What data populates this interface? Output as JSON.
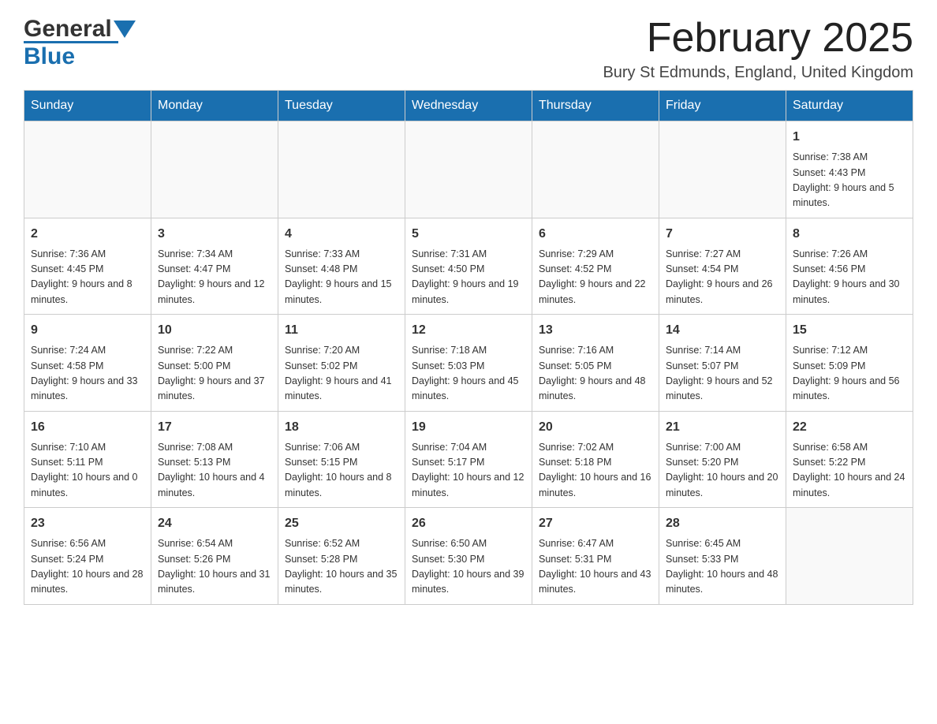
{
  "header": {
    "logo_general": "General",
    "logo_blue": "Blue",
    "title": "February 2025",
    "location": "Bury St Edmunds, England, United Kingdom"
  },
  "weekdays": [
    "Sunday",
    "Monday",
    "Tuesday",
    "Wednesday",
    "Thursday",
    "Friday",
    "Saturday"
  ],
  "weeks": [
    [
      {
        "day": "",
        "sunrise": "",
        "sunset": "",
        "daylight": ""
      },
      {
        "day": "",
        "sunrise": "",
        "sunset": "",
        "daylight": ""
      },
      {
        "day": "",
        "sunrise": "",
        "sunset": "",
        "daylight": ""
      },
      {
        "day": "",
        "sunrise": "",
        "sunset": "",
        "daylight": ""
      },
      {
        "day": "",
        "sunrise": "",
        "sunset": "",
        "daylight": ""
      },
      {
        "day": "",
        "sunrise": "",
        "sunset": "",
        "daylight": ""
      },
      {
        "day": "1",
        "sunrise": "Sunrise: 7:38 AM",
        "sunset": "Sunset: 4:43 PM",
        "daylight": "Daylight: 9 hours and 5 minutes."
      }
    ],
    [
      {
        "day": "2",
        "sunrise": "Sunrise: 7:36 AM",
        "sunset": "Sunset: 4:45 PM",
        "daylight": "Daylight: 9 hours and 8 minutes."
      },
      {
        "day": "3",
        "sunrise": "Sunrise: 7:34 AM",
        "sunset": "Sunset: 4:47 PM",
        "daylight": "Daylight: 9 hours and 12 minutes."
      },
      {
        "day": "4",
        "sunrise": "Sunrise: 7:33 AM",
        "sunset": "Sunset: 4:48 PM",
        "daylight": "Daylight: 9 hours and 15 minutes."
      },
      {
        "day": "5",
        "sunrise": "Sunrise: 7:31 AM",
        "sunset": "Sunset: 4:50 PM",
        "daylight": "Daylight: 9 hours and 19 minutes."
      },
      {
        "day": "6",
        "sunrise": "Sunrise: 7:29 AM",
        "sunset": "Sunset: 4:52 PM",
        "daylight": "Daylight: 9 hours and 22 minutes."
      },
      {
        "day": "7",
        "sunrise": "Sunrise: 7:27 AM",
        "sunset": "Sunset: 4:54 PM",
        "daylight": "Daylight: 9 hours and 26 minutes."
      },
      {
        "day": "8",
        "sunrise": "Sunrise: 7:26 AM",
        "sunset": "Sunset: 4:56 PM",
        "daylight": "Daylight: 9 hours and 30 minutes."
      }
    ],
    [
      {
        "day": "9",
        "sunrise": "Sunrise: 7:24 AM",
        "sunset": "Sunset: 4:58 PM",
        "daylight": "Daylight: 9 hours and 33 minutes."
      },
      {
        "day": "10",
        "sunrise": "Sunrise: 7:22 AM",
        "sunset": "Sunset: 5:00 PM",
        "daylight": "Daylight: 9 hours and 37 minutes."
      },
      {
        "day": "11",
        "sunrise": "Sunrise: 7:20 AM",
        "sunset": "Sunset: 5:02 PM",
        "daylight": "Daylight: 9 hours and 41 minutes."
      },
      {
        "day": "12",
        "sunrise": "Sunrise: 7:18 AM",
        "sunset": "Sunset: 5:03 PM",
        "daylight": "Daylight: 9 hours and 45 minutes."
      },
      {
        "day": "13",
        "sunrise": "Sunrise: 7:16 AM",
        "sunset": "Sunset: 5:05 PM",
        "daylight": "Daylight: 9 hours and 48 minutes."
      },
      {
        "day": "14",
        "sunrise": "Sunrise: 7:14 AM",
        "sunset": "Sunset: 5:07 PM",
        "daylight": "Daylight: 9 hours and 52 minutes."
      },
      {
        "day": "15",
        "sunrise": "Sunrise: 7:12 AM",
        "sunset": "Sunset: 5:09 PM",
        "daylight": "Daylight: 9 hours and 56 minutes."
      }
    ],
    [
      {
        "day": "16",
        "sunrise": "Sunrise: 7:10 AM",
        "sunset": "Sunset: 5:11 PM",
        "daylight": "Daylight: 10 hours and 0 minutes."
      },
      {
        "day": "17",
        "sunrise": "Sunrise: 7:08 AM",
        "sunset": "Sunset: 5:13 PM",
        "daylight": "Daylight: 10 hours and 4 minutes."
      },
      {
        "day": "18",
        "sunrise": "Sunrise: 7:06 AM",
        "sunset": "Sunset: 5:15 PM",
        "daylight": "Daylight: 10 hours and 8 minutes."
      },
      {
        "day": "19",
        "sunrise": "Sunrise: 7:04 AM",
        "sunset": "Sunset: 5:17 PM",
        "daylight": "Daylight: 10 hours and 12 minutes."
      },
      {
        "day": "20",
        "sunrise": "Sunrise: 7:02 AM",
        "sunset": "Sunset: 5:18 PM",
        "daylight": "Daylight: 10 hours and 16 minutes."
      },
      {
        "day": "21",
        "sunrise": "Sunrise: 7:00 AM",
        "sunset": "Sunset: 5:20 PM",
        "daylight": "Daylight: 10 hours and 20 minutes."
      },
      {
        "day": "22",
        "sunrise": "Sunrise: 6:58 AM",
        "sunset": "Sunset: 5:22 PM",
        "daylight": "Daylight: 10 hours and 24 minutes."
      }
    ],
    [
      {
        "day": "23",
        "sunrise": "Sunrise: 6:56 AM",
        "sunset": "Sunset: 5:24 PM",
        "daylight": "Daylight: 10 hours and 28 minutes."
      },
      {
        "day": "24",
        "sunrise": "Sunrise: 6:54 AM",
        "sunset": "Sunset: 5:26 PM",
        "daylight": "Daylight: 10 hours and 31 minutes."
      },
      {
        "day": "25",
        "sunrise": "Sunrise: 6:52 AM",
        "sunset": "Sunset: 5:28 PM",
        "daylight": "Daylight: 10 hours and 35 minutes."
      },
      {
        "day": "26",
        "sunrise": "Sunrise: 6:50 AM",
        "sunset": "Sunset: 5:30 PM",
        "daylight": "Daylight: 10 hours and 39 minutes."
      },
      {
        "day": "27",
        "sunrise": "Sunrise: 6:47 AM",
        "sunset": "Sunset: 5:31 PM",
        "daylight": "Daylight: 10 hours and 43 minutes."
      },
      {
        "day": "28",
        "sunrise": "Sunrise: 6:45 AM",
        "sunset": "Sunset: 5:33 PM",
        "daylight": "Daylight: 10 hours and 48 minutes."
      },
      {
        "day": "",
        "sunrise": "",
        "sunset": "",
        "daylight": ""
      }
    ]
  ]
}
